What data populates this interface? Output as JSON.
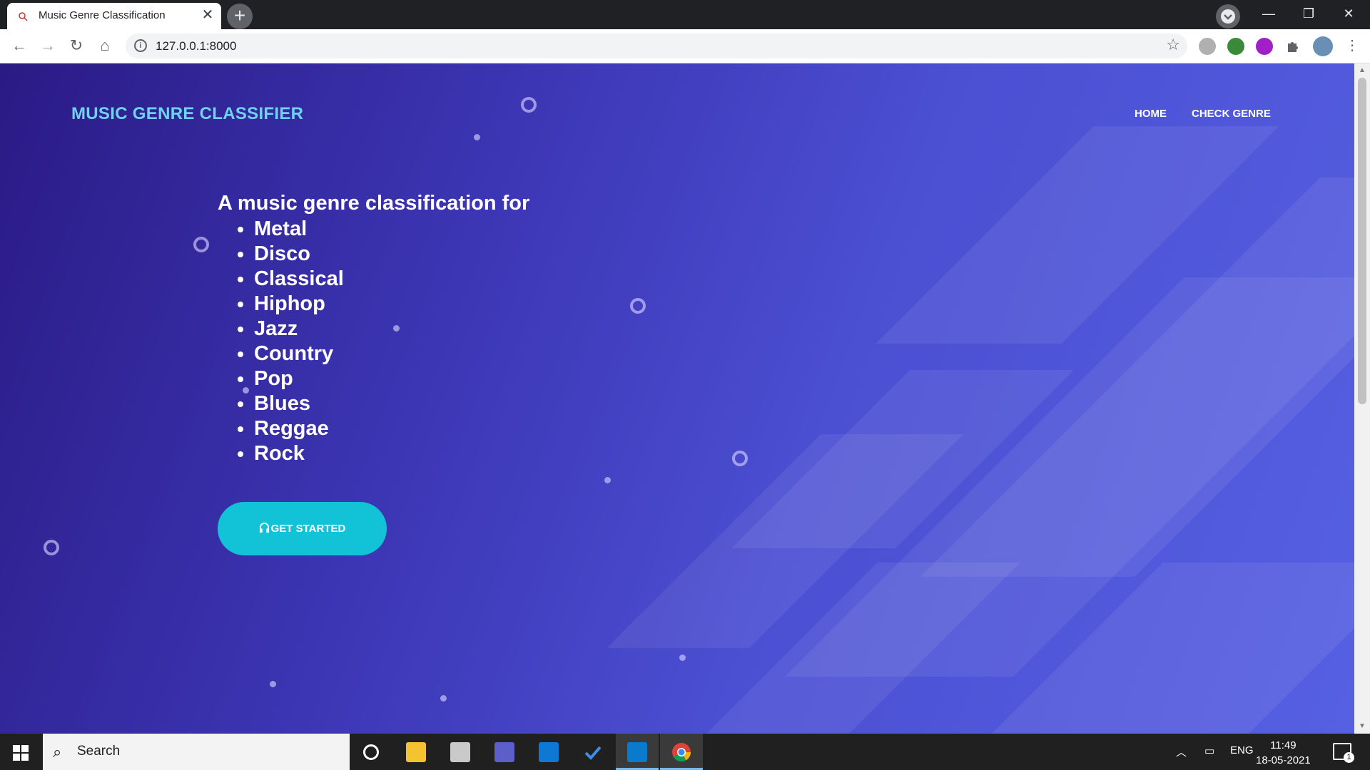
{
  "browser": {
    "tab_title": "Music Genre Classification",
    "tab_close": "✕",
    "new_tab": "+",
    "url": "127.0.0.1:8000",
    "window_controls": {
      "minimize": "—",
      "restore": "❐",
      "close": "✕"
    },
    "nav": {
      "back": "←",
      "forward": "→",
      "reload": "↻",
      "home": "⌂"
    },
    "bookmark_star": "☆",
    "info_icon": "i",
    "extension_icons": [
      "bug-extension-icon",
      "tree-extension-icon",
      "headphones-extension-icon",
      "puzzle-extensions-icon",
      "profile-avatar-icon",
      "menu-kebab-icon"
    ]
  },
  "site": {
    "logo": "MUSIC GENRE CLASSIFIER",
    "nav_links": [
      "HOME",
      "CHECK GENRE"
    ],
    "headline": "A music genre classification for",
    "genres": [
      "Metal",
      "Disco",
      "Classical",
      "Hiphop",
      "Jazz",
      "Country",
      "Pop",
      "Blues",
      "Reggae",
      "Rock"
    ],
    "cta_label": "GET STARTED",
    "cta_icon": "headphones-icon",
    "colors": {
      "logo": "#6fd3f0",
      "cta": "#12c3d8",
      "bg_start": "#2a1a85",
      "bg_end": "#5660e2"
    }
  },
  "taskbar": {
    "search_placeholder": "Search",
    "apps": [
      "cortana-icon",
      "file-explorer-icon",
      "photos-app-icon",
      "teams-icon",
      "mail-icon",
      "todo-icon",
      "vscode-icon",
      "chrome-icon"
    ],
    "language": "ENG",
    "time": "11:49",
    "date": "18-05-2021",
    "notification_count": "1"
  }
}
